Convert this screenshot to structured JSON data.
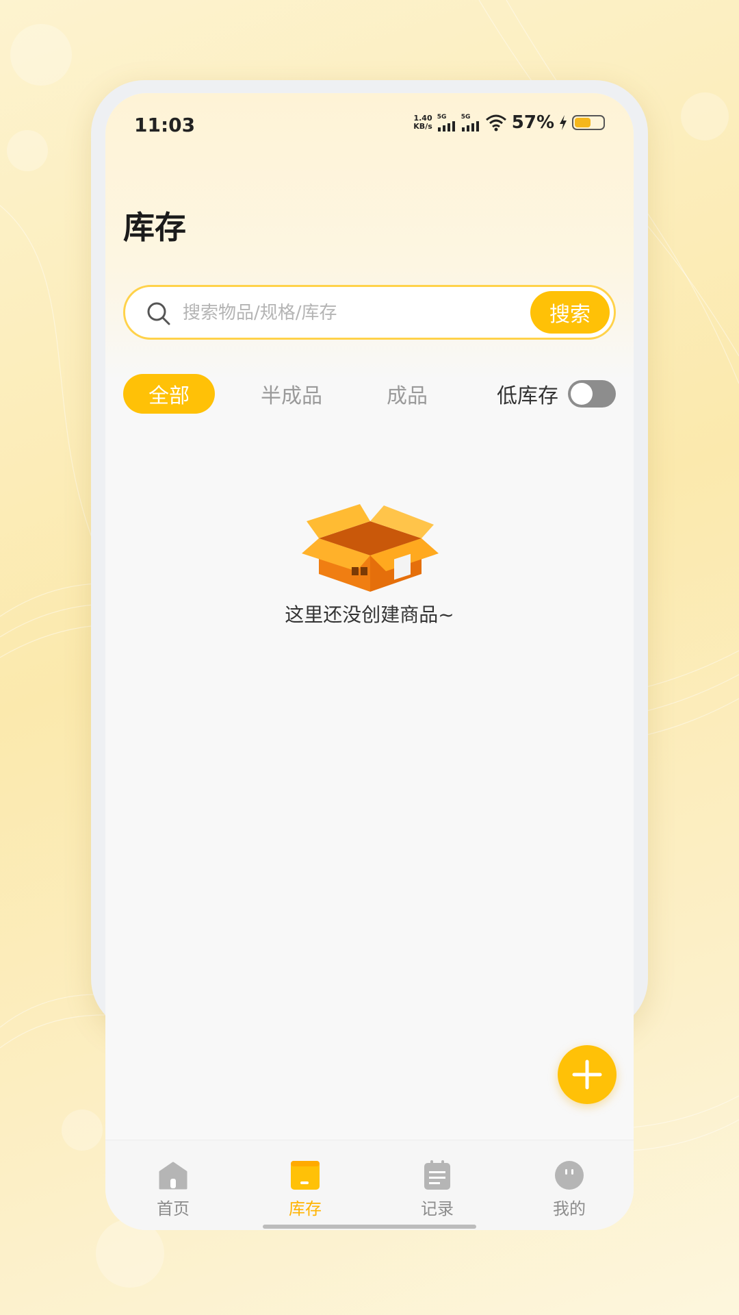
{
  "status_bar": {
    "time": "11:03",
    "net_speed_value": "1.40",
    "net_speed_unit": "KB/s",
    "signal1_label": "5G",
    "signal2_label": "5G",
    "battery_percent": "57%",
    "battery_level": 0.57
  },
  "page": {
    "title": "库存"
  },
  "search": {
    "placeholder": "搜索物品/规格/库存",
    "button_label": "搜索"
  },
  "tabs": [
    {
      "label": "全部",
      "active": true
    },
    {
      "label": "半成品",
      "active": false
    },
    {
      "label": "成品",
      "active": false
    }
  ],
  "low_stock": {
    "label": "低库存",
    "enabled": false
  },
  "empty_state": {
    "message": "这里还没创建商品~",
    "icon": "open-box-illustration"
  },
  "fab": {
    "icon": "plus-icon"
  },
  "bottom_nav": [
    {
      "label": "首页",
      "icon": "home-icon",
      "active": false
    },
    {
      "label": "库存",
      "icon": "inventory-icon",
      "active": true
    },
    {
      "label": "记录",
      "icon": "clipboard-icon",
      "active": false
    },
    {
      "label": "我的",
      "icon": "profile-icon",
      "active": false
    }
  ],
  "colors": {
    "accent": "#ffc107",
    "active_nav": "#ffb300",
    "background": "#f8f8f8"
  }
}
